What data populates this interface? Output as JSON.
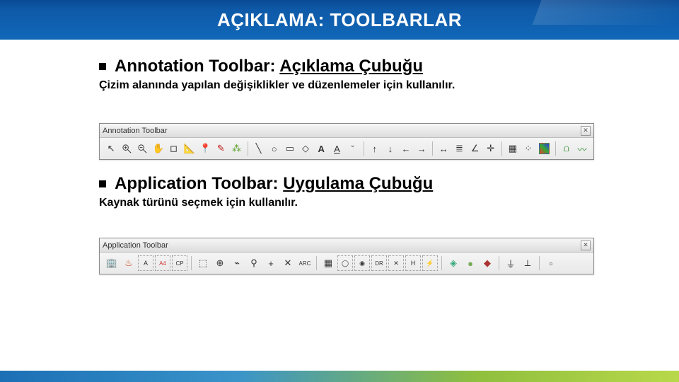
{
  "header": {
    "title": "AÇIKLAMA: TOOLBARLAR"
  },
  "sections": [
    {
      "label_bold": "Annotation Toolbar: ",
      "label_trans": "Açıklama Çubuğu",
      "desc": "Çizim alanında yapılan değişiklikler ve düzenlemeler için kullanılır.",
      "toolbar_title": "Annotation Toolbar"
    },
    {
      "label_bold": "Application Toolbar: ",
      "label_trans": "Uygulama Çubuğu",
      "desc": "Kaynak türünü seçmek için kullanılır.",
      "toolbar_title": "Application Toolbar"
    }
  ],
  "toolbars": {
    "annotation_icons": [
      "pointer",
      "zoom-in",
      "zoom-out",
      "pan",
      "crop",
      "ruler",
      "pushpin",
      "pen",
      "wand",
      "line",
      "circle",
      "rect",
      "polygon",
      "text",
      "underline",
      "caret",
      "arrow-up",
      "arrow-down",
      "arrow-left",
      "arrow-right",
      "dimension",
      "align",
      "angle",
      "crosshair",
      "grid",
      "nodes",
      "colors",
      "sparkline",
      "curve"
    ],
    "application_icons": [
      "building",
      "flame",
      "box-a",
      "box-a4",
      "box-cp",
      "cube",
      "circle-plus",
      "leaf",
      "wand2",
      "plus",
      "cross",
      "arc",
      "grid",
      "box-o",
      "box-o2",
      "box-dr",
      "box-x",
      "box-h",
      "box-z",
      "box3d",
      "sphere",
      "cube-red",
      "ground",
      "ground2",
      "box-end"
    ]
  }
}
